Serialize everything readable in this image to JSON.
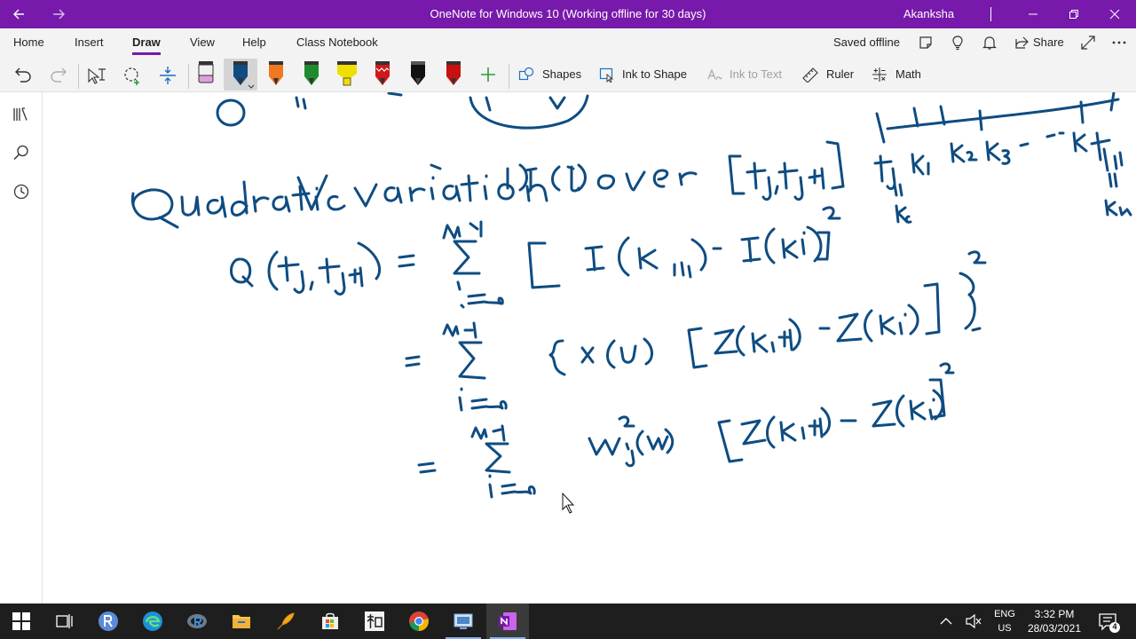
{
  "window": {
    "title": "OneNote for Windows 10 (Working offline for 30 days)",
    "user": "Akanksha",
    "brand_color": "#7719aa"
  },
  "menu": {
    "tabs": [
      {
        "label": "Home"
      },
      {
        "label": "Insert"
      },
      {
        "label": "Draw"
      },
      {
        "label": "View"
      },
      {
        "label": "Help"
      },
      {
        "label": "Class Notebook"
      }
    ],
    "active_tab": "Draw",
    "saved_status": "Saved offline",
    "share_label": "Share"
  },
  "toolbar": {
    "shapes_label": "Shapes",
    "ink_to_shape_label": "Ink to Shape",
    "ink_to_text_label": "Ink to Text",
    "ruler_label": "Ruler",
    "math_label": "Math",
    "pens": [
      {
        "name": "eraser",
        "color": "#e0a0e0"
      },
      {
        "name": "pen-blue-selected",
        "color": "#0f4c81"
      },
      {
        "name": "pen-orange",
        "color": "#f07820"
      },
      {
        "name": "pen-green",
        "color": "#1e8c2e"
      },
      {
        "name": "highlighter-yellow",
        "color": "#f0e000"
      },
      {
        "name": "pen-red-pattern",
        "color": "#d01818"
      },
      {
        "name": "pen-black",
        "color": "#111111"
      },
      {
        "name": "pen-red",
        "color": "#c81010"
      }
    ],
    "ink_color": "#0f4c81"
  },
  "taskbar": {
    "language_line1": "ENG",
    "language_line2": "US",
    "time": "3:32 PM",
    "date": "28/03/2021",
    "notification_count": "4"
  }
}
